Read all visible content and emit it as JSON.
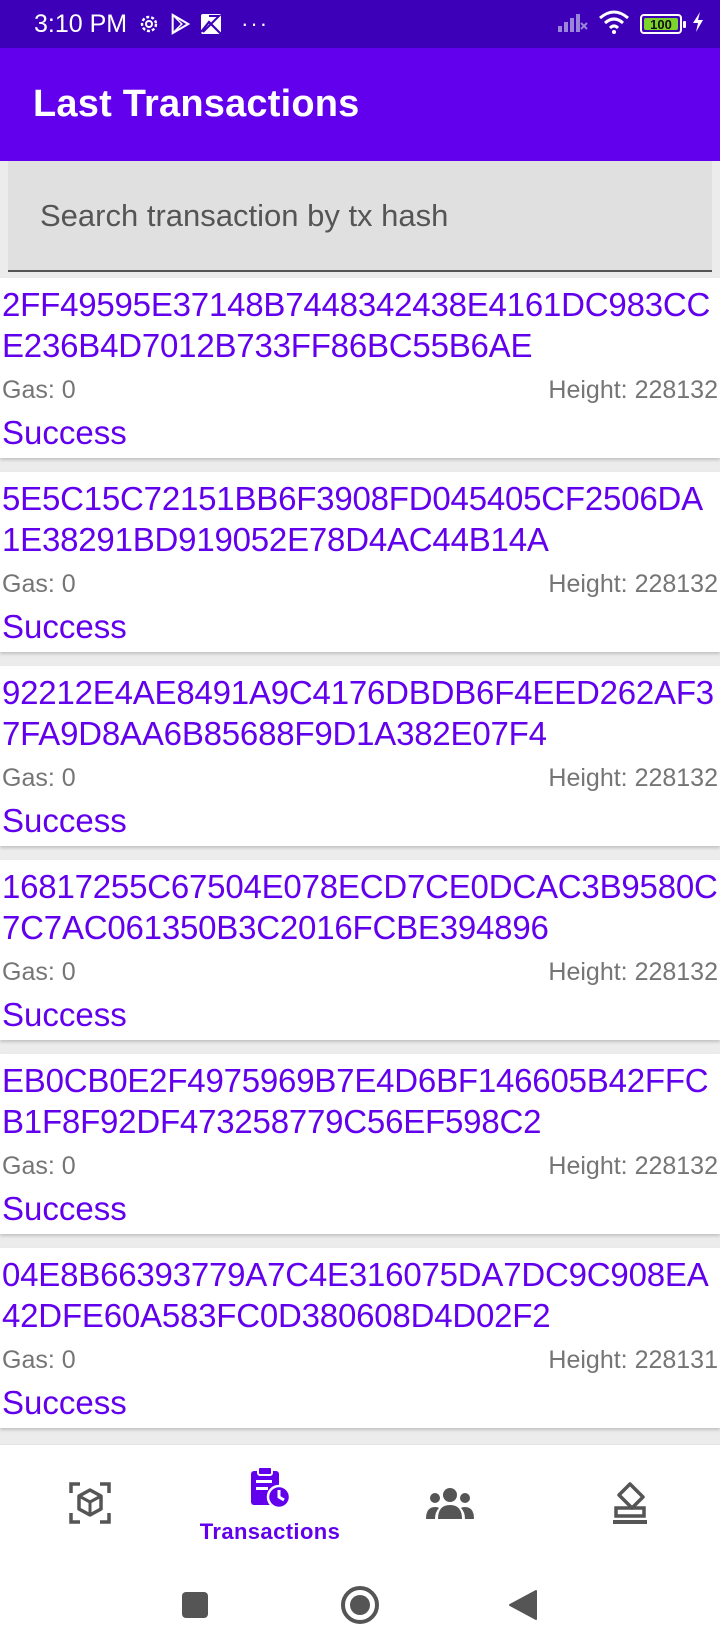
{
  "status_bar": {
    "time": "3:10 PM",
    "battery_level": "100",
    "battery_fraction": 1.0,
    "icons": [
      "settings-gear-icon",
      "play-store-icon",
      "gallery-icon",
      "more-dots-icon",
      "cell-signal-icon",
      "wifi-icon",
      "battery-icon",
      "charging-icon"
    ],
    "more_text": "···"
  },
  "app_bar": {
    "title": "Last Transactions"
  },
  "search": {
    "placeholder": "Search transaction by tx hash",
    "value": ""
  },
  "colors": {
    "primary": "#6200ee",
    "primary_dark": "#3d00b8",
    "battery": "#7cd32c"
  },
  "transactions": [
    {
      "hash": "2FF49595E37148B7448342438E4161DC983CCE236B4D7012B733FF86BC55B6AE",
      "gas": "Gas: 0",
      "height": "Height: 228132",
      "status": "Success"
    },
    {
      "hash": "5E5C15C72151BB6F3908FD045405CF2506DA1E38291BD919052E78D4AC44B14A",
      "gas": "Gas: 0",
      "height": "Height: 228132",
      "status": "Success"
    },
    {
      "hash": "92212E4AE8491A9C4176DBDB6F4EED262AF37FA9D8AA6B85688F9D1A382E07F4",
      "gas": "Gas: 0",
      "height": "Height: 228132",
      "status": "Success"
    },
    {
      "hash": "16817255C67504E078ECD7CE0DCAC3B9580C7C7AC061350B3C2016FCBE394896",
      "gas": "Gas: 0",
      "height": "Height: 228132",
      "status": "Success"
    },
    {
      "hash": "EB0CB0E2F4975969B7E4D6BF146605B42FFCB1F8F92DF473258779C56EF598C2",
      "gas": "Gas: 0",
      "height": "Height: 228132",
      "status": "Success"
    },
    {
      "hash": "04E8B66393779A7C4E316075DA7DC9C908EA42DFE60A583FC0D380608D4D02F2",
      "gas": "Gas: 0",
      "height": "Height: 228131",
      "status": "Success"
    }
  ],
  "bottom_nav": {
    "items": [
      {
        "icon": "cube-scan-icon",
        "label": "",
        "active": false
      },
      {
        "icon": "transactions-clipboard-icon",
        "label": "Transactions",
        "active": true
      },
      {
        "icon": "people-group-icon",
        "label": "",
        "active": false
      },
      {
        "icon": "stamp-icon",
        "label": "",
        "active": false
      }
    ]
  },
  "system_nav": {
    "buttons": [
      "recents-square-icon",
      "home-circle-icon",
      "back-triangle-icon"
    ]
  }
}
